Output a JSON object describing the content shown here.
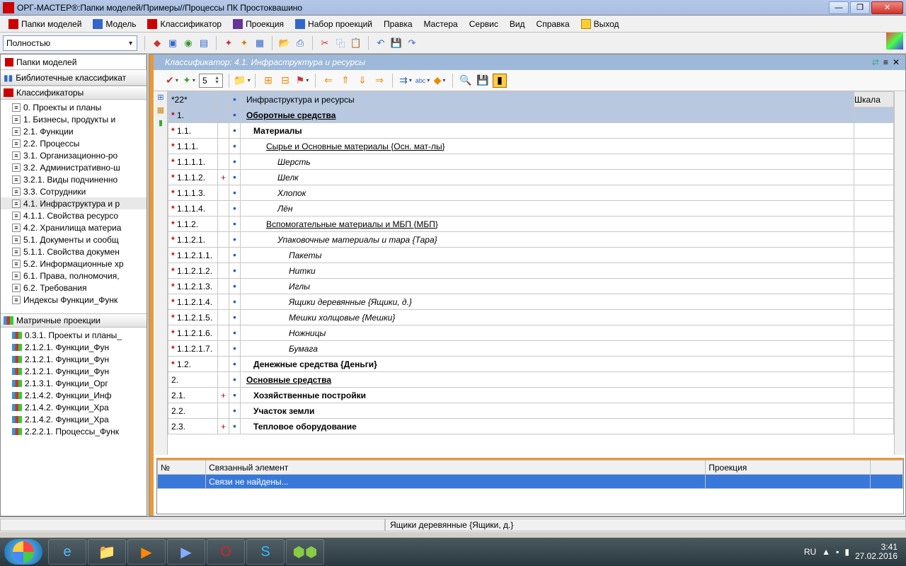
{
  "window": {
    "title": "ОРГ-МАСТЕР®:Папки моделей/Примеры//Процессы ПК Простоквашино"
  },
  "menu": {
    "items": [
      {
        "label": "Папки моделей"
      },
      {
        "label": "Модель"
      },
      {
        "label": "Классификатор"
      },
      {
        "label": "Проекция"
      },
      {
        "label": "Набор проекций"
      },
      {
        "label": "Правка"
      },
      {
        "label": "Мастера"
      },
      {
        "label": "Сервис"
      },
      {
        "label": "Вид"
      },
      {
        "label": "Справка"
      },
      {
        "label": "Выход"
      }
    ]
  },
  "filter": {
    "value": "Полностью"
  },
  "sidebar": {
    "header1": "Папки моделей",
    "header2": "Библиотечные классификат",
    "section1": "Классификаторы",
    "tree1": [
      "0. Проекты и планы",
      "1. Бизнесы, продукты и",
      "2.1. Функции",
      "2.2. Процессы",
      "3.1. Организационно-ро",
      "3.2. Административно-ш",
      "3.2.1. Виды подчиненно",
      "3.3. Сотрудники",
      "4.1. Инфраструктура и р",
      "4.1.1. Свойства ресурсо",
      "4.2. Хранилища материа",
      "5.1. Документы и сообщ",
      "5.1.1. Свойства докумен",
      "5.2. Информационные хр",
      "6.1. Права, полномочия,",
      "6.2. Требования",
      "Индексы Функции_Функ"
    ],
    "section2": "Матричные проекции",
    "tree2": [
      "0.3.1. Проекты и планы_",
      "2.1.2.1. Функции_Фун",
      "2.1.2.1. Функции_Фун",
      "2.1.2.1. Функции_Фун",
      "2.1.3.1. Функции_Орг",
      "2.1.4.2. Функции_Инф",
      "2.1.4.2. Функции_Хра",
      "2.1.4.2. Функции_Хра",
      "2.2.2.1. Процессы_Функ"
    ]
  },
  "classifier": {
    "title": "Классификатор: 4.1. Инфраструктура и ресурсы",
    "spin": "5",
    "cols": {
      "shkala": "Шкала"
    },
    "rows": [
      {
        "num": "*22*",
        "mark": "•",
        "name": "Инфраструктура и ресурсы",
        "cls": "row-hdr indent0"
      },
      {
        "num": "1.",
        "star": "*",
        "mark": "•",
        "name": "Оборотные средства",
        "cls": "row-bold row-u row-hdr indent0"
      },
      {
        "num": "1.1.",
        "star": "*",
        "mark": "•",
        "name": "Материалы",
        "cls": "row-bold indent1"
      },
      {
        "num": "1.1.1.",
        "star": "*",
        "mark": "•",
        "name": "Сырье и Основные материалы {Осн. мат-лы}",
        "cls": "row-u indent2"
      },
      {
        "num": "1.1.1.1.",
        "star": "*",
        "mark": "•",
        "name": "Шерсть",
        "cls": "italic indent3"
      },
      {
        "num": "1.1.1.2.",
        "star": "*",
        "plus": "+",
        "mark": "•",
        "name": "Шелк",
        "cls": "italic indent3"
      },
      {
        "num": "1.1.1.3.",
        "star": "*",
        "mark": "•",
        "name": "Хлопок",
        "cls": "italic indent3"
      },
      {
        "num": "1.1.1.4.",
        "star": "*",
        "mark": "•",
        "name": "Лён",
        "cls": "italic indent3"
      },
      {
        "num": "1.1.2.",
        "star": "*",
        "mark": "•",
        "name": "Вспомогательные материалы и МБП {МБП}",
        "cls": "row-u indent2"
      },
      {
        "num": "1.1.2.1.",
        "star": "*",
        "mark": "•",
        "name": "Упаковочные материалы и тара {Тара}",
        "cls": "italic indent3"
      },
      {
        "num": "1.1.2.1.1.",
        "star": "*",
        "mark": "•",
        "name": "Пакеты",
        "cls": "italic indent4"
      },
      {
        "num": "1.1.2.1.2.",
        "star": "*",
        "mark": "•",
        "name": "Нитки",
        "cls": "italic indent4"
      },
      {
        "num": "1.1.2.1.3.",
        "star": "*",
        "mark": "•",
        "name": "Иглы",
        "cls": "italic indent4"
      },
      {
        "num": "1.1.2.1.4.",
        "star": "*",
        "mark": "•",
        "name": "Ящики деревянные {Ящики, д.}",
        "cls": "italic indent4"
      },
      {
        "num": "1.1.2.1.5.",
        "star": "*",
        "mark": "•",
        "name": "Мешки холщовые {Мешки}",
        "cls": "italic indent4"
      },
      {
        "num": "1.1.2.1.6.",
        "star": "*",
        "mark": "•",
        "name": "Ножницы",
        "cls": "italic indent4"
      },
      {
        "num": "1.1.2.1.7.",
        "star": "*",
        "mark": "•",
        "name": "Бумага",
        "cls": "italic indent4"
      },
      {
        "num": "1.2.",
        "star": "*",
        "mark": "•",
        "name": "Денежные средства {Деньги}",
        "cls": "row-bold indent1"
      },
      {
        "num": "2.",
        "mark": "•",
        "name": "Основные средства",
        "cls": "row-bold row-u indent0"
      },
      {
        "num": "2.1.",
        "plus": "+",
        "mark": "•",
        "name": "Хозяйственные постройки",
        "cls": "row-bold indent1"
      },
      {
        "num": "2.2.",
        "mark": "•",
        "name": "Участок земли",
        "cls": "row-bold indent1"
      },
      {
        "num": "2.3.",
        "plus": "+",
        "mark": "•",
        "name": "Тепловое оборудование",
        "cls": "row-bold indent1"
      }
    ]
  },
  "links": {
    "cols": {
      "num": "№",
      "elem": "Связанный элемент",
      "proj": "Проекция"
    },
    "empty": "Связи не найдены..."
  },
  "status": {
    "text": "Ящики деревянные {Ящики, д.}"
  },
  "tray": {
    "lang": "RU",
    "time": "3:41",
    "date": "27.02.2016"
  }
}
